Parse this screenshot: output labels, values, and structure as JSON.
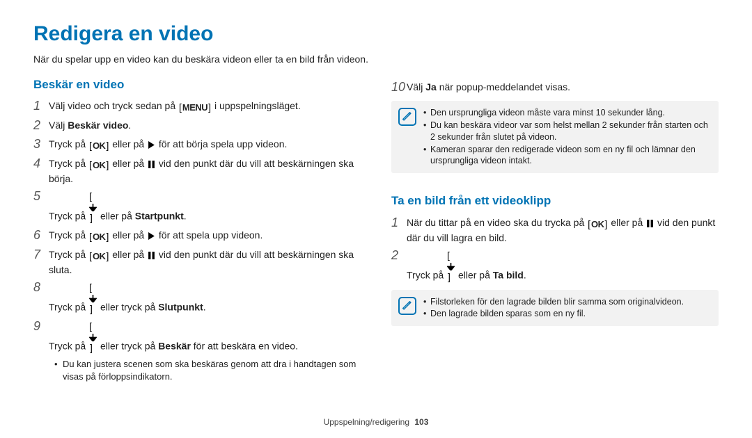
{
  "title": "Redigera en video",
  "intro": "När du spelar upp en video kan du beskära videon eller ta en bild från videon.",
  "footer": {
    "section": "Uppspelning/redigering",
    "page": "103"
  },
  "left": {
    "heading": "Beskär en video",
    "steps": {
      "1": {
        "pre": "Välj video och tryck sedan på",
        "post": "i uppspelningsläget."
      },
      "2": {
        "pre": "Välj",
        "bold": "Beskär video",
        "post": "."
      },
      "3": {
        "pre": "Tryck på",
        "mid": "eller på",
        "post": "för att börja spela upp videon."
      },
      "4": {
        "pre": "Tryck på",
        "mid": "eller på",
        "post": "vid den punkt där du vill att beskärningen ska börja."
      },
      "5": {
        "pre": "Tryck på",
        "mid": "eller på",
        "bold": "Startpunkt",
        "post": "."
      },
      "6": {
        "pre": "Tryck på",
        "mid": "eller på",
        "post": "för att spela upp videon."
      },
      "7": {
        "pre": "Tryck på",
        "mid": "eller på",
        "post": "vid den punkt där du vill att beskärningen ska sluta."
      },
      "8": {
        "pre": "Tryck på",
        "mid": "eller tryck på",
        "bold": "Slutpunkt",
        "post": "."
      },
      "9": {
        "pre": "Tryck på",
        "mid": "eller tryck på",
        "bold": "Beskär",
        "post": "för att beskära en video."
      }
    },
    "sub": "Du kan justera scenen som ska beskäras genom att dra i handtagen som visas på förloppsindikatorn."
  },
  "right": {
    "step10": {
      "pre": "Välj",
      "bold": "Ja",
      "post": "när popup-meddelandet visas."
    },
    "note1": {
      "a": "Den ursprungliga videon måste vara minst 10 sekunder lång.",
      "b": "Du kan beskära videor var som helst mellan 2 sekunder från starten och 2 sekunder från slutet på videon.",
      "c": "Kameran sparar den redigerade videon som en ny fil och lämnar den ursprungliga videon intakt."
    },
    "heading2": "Ta en bild från ett videoklipp",
    "capSteps": {
      "1": {
        "pre": "När du tittar på en video ska du trycka på",
        "mid": "eller på",
        "post": "vid den punkt där du vill lagra en bild."
      },
      "2": {
        "pre": "Tryck på",
        "mid": "eller på",
        "bold": "Ta bild",
        "post": "."
      }
    },
    "note2": {
      "a": "Filstorleken för den lagrade bilden blir samma som originalvideon.",
      "b": "Den lagrade bilden sparas som en ny fil."
    }
  },
  "icons": {
    "menu": "MENU",
    "ok": "OK"
  }
}
